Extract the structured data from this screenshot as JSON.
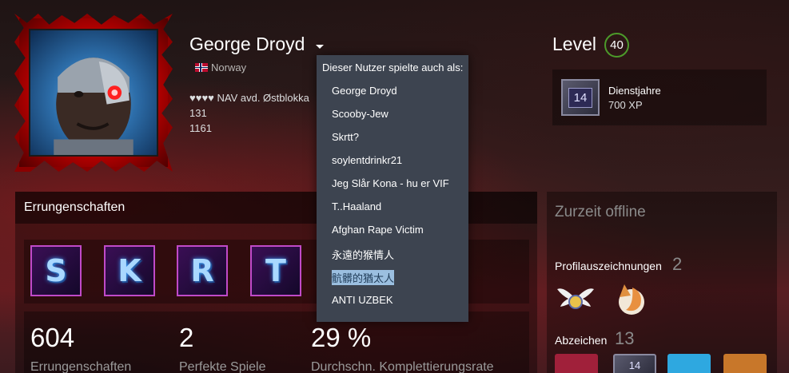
{
  "profile": {
    "username": "George Droyd",
    "country": "Norway",
    "summary": [
      "♥♥♥♥ NAV avd. Østblokka",
      "131",
      "1161"
    ]
  },
  "level": {
    "label": "Level",
    "value": "40"
  },
  "service_years": {
    "icon_value": "14",
    "title": "Dienstjahre",
    "xp": "700 XP"
  },
  "dropdown": {
    "header": "Dieser Nutzer spielte auch als:",
    "items": [
      "George Droyd",
      "Scooby-Jew",
      "Skrtt?",
      "soylentdrinkr21",
      "Jeg Slår Kona - hu er VIF",
      "T..Haaland",
      "Afghan Rape Victim",
      "永遠的猴情人",
      "骯髒的猶太人",
      "ANTI UZBEK"
    ],
    "selected_index": 8
  },
  "achievements": {
    "title": "Errungenschaften",
    "tiles": [
      "S",
      "K",
      "R",
      "T"
    ],
    "stats": [
      {
        "value": "604",
        "label": "Errungenschaften"
      },
      {
        "value": "2",
        "label": "Perfekte Spiele"
      },
      {
        "value": "29 %",
        "label": "Durchschn. Komplettierungsrate"
      }
    ]
  },
  "status": {
    "offline": "Zurzeit offline",
    "profile_awards_label": "Profilauszeichnungen",
    "profile_awards_count": "2",
    "badges_label": "Abzeichen",
    "badges_count": "13",
    "badge_preview_value": "14"
  },
  "colors": {
    "dropdown_bg": "#3d4450",
    "selected_highlight": "#9bbfe0",
    "level_ring": "#4c9a2a"
  }
}
